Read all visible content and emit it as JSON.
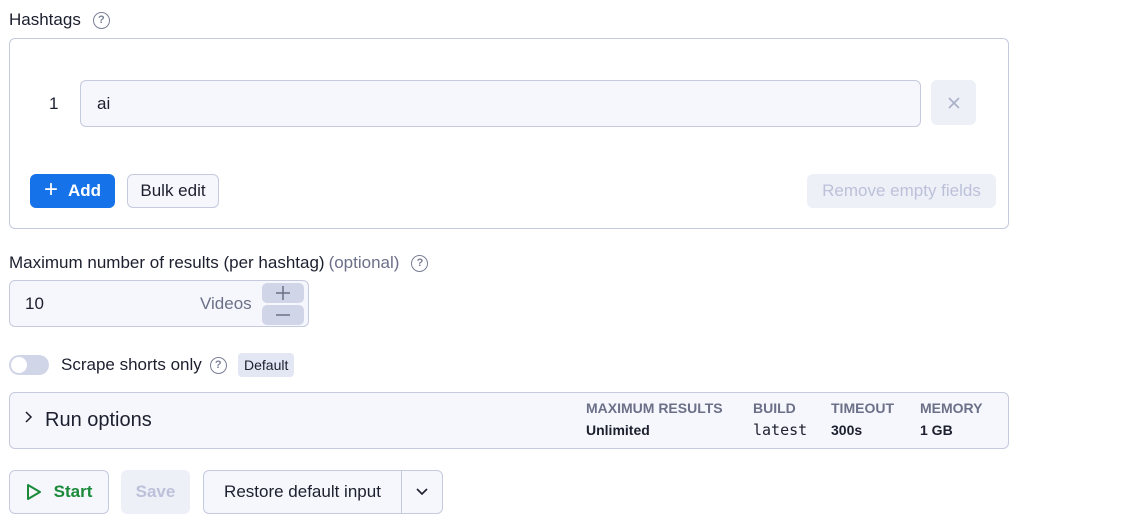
{
  "hashtags": {
    "label": "Hashtags",
    "help_icon": "question-circle-icon",
    "items": [
      {
        "index": "1",
        "value": "ai"
      }
    ],
    "remove_icon": "close-icon",
    "add_label": "Add",
    "add_icon": "plus-icon",
    "bulk_edit_label": "Bulk edit",
    "remove_empty_label": "Remove empty fields"
  },
  "max_results": {
    "label": "Maximum number of results (per hashtag)",
    "optional": "(optional)",
    "value": "10",
    "unit": "Videos",
    "increment_icon": "plus-icon",
    "decrement_icon": "minus-icon"
  },
  "shorts": {
    "label": "Scrape shorts only",
    "enabled": false,
    "badge": "Default"
  },
  "run_options": {
    "title": "Run options",
    "stats": [
      {
        "label": "MAXIMUM RESULTS",
        "value": "Unlimited"
      },
      {
        "label": "BUILD",
        "value": "latest"
      },
      {
        "label": "TIMEOUT",
        "value": "300s"
      },
      {
        "label": "MEMORY",
        "value": "1 GB"
      }
    ]
  },
  "actions": {
    "start_label": "Start",
    "save_label": "Save",
    "restore_label": "Restore default input"
  },
  "colors": {
    "primary": "#1672e8",
    "start_green": "#1a8a3a",
    "border": "#c5cade"
  }
}
